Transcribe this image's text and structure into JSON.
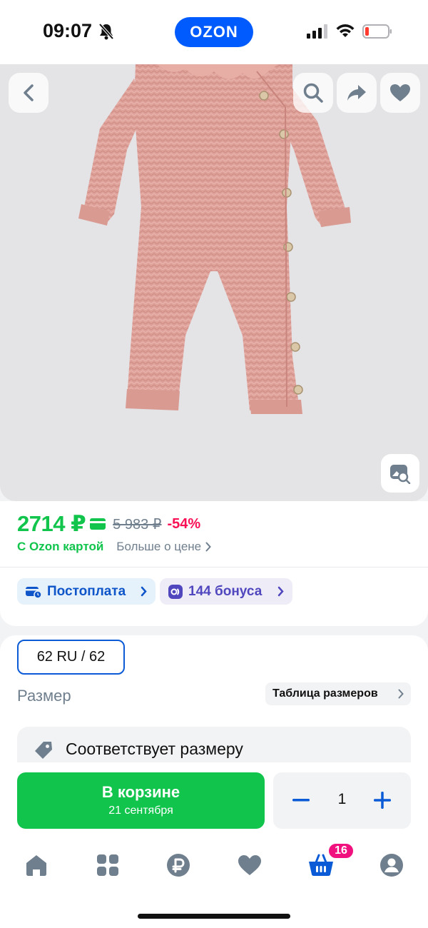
{
  "status_bar": {
    "time": "09:07",
    "logo": "OZON",
    "icons": [
      "bell-slash-icon",
      "cellular-signal-icon",
      "wifi-icon",
      "battery-low-icon"
    ]
  },
  "product_image": {
    "description": "pink knitted baby romper",
    "buttons": [
      "back-icon",
      "search-icon",
      "share-icon",
      "heart-icon",
      "image-search-icon"
    ]
  },
  "price": {
    "current": "2714 ₽",
    "old": "5 983 ₽",
    "discount": "-54%",
    "ozon_card_label": "С Ozon картой",
    "more_price_link": "Больше о цене"
  },
  "chips": {
    "postpay": "Постоплата",
    "bonus": "144 бонуса"
  },
  "size": {
    "selected": "62 RU / 62",
    "label": "Размер",
    "size_table_button": "Таблица размеров",
    "fit_text": "Соответствует размеру"
  },
  "action": {
    "cart_title": "В корзине",
    "cart_date": "21 сентября",
    "quantity": "1"
  },
  "tab_bar": {
    "tabs": [
      "home-icon",
      "catalog-icon",
      "ozon-pay-icon",
      "favorites-icon",
      "cart-icon",
      "profile-icon"
    ],
    "cart_badge": "16"
  },
  "colors": {
    "brand_blue": "#005bff",
    "price_green": "#10c44c",
    "discount_red": "#f91155",
    "badge_pink": "#f1117e"
  }
}
